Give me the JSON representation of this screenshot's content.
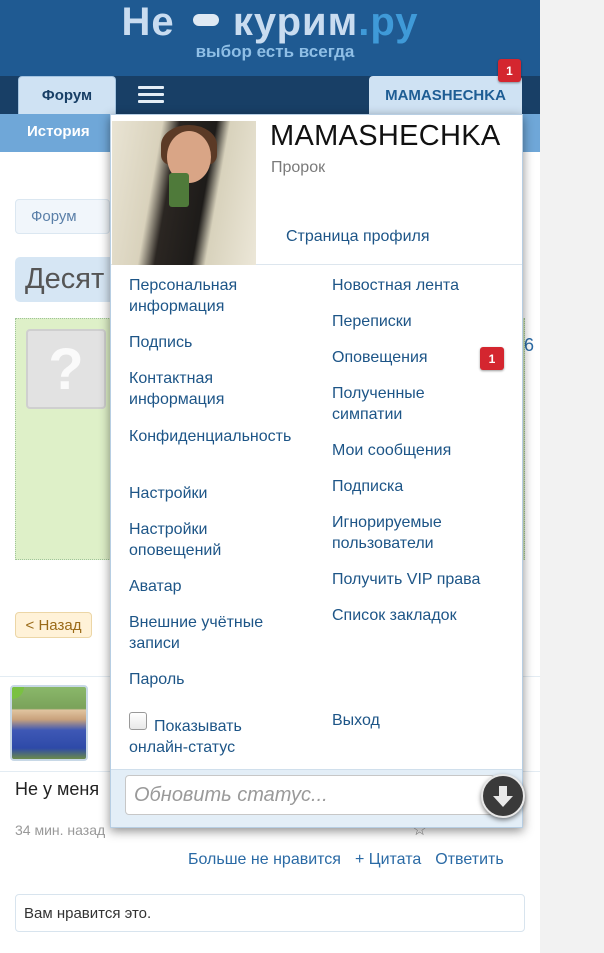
{
  "header": {
    "logo_main": "Не",
    "logo_mid": "курим",
    "logo_ru": ".ру",
    "logo_sub": "выбор есть всегда",
    "tab_forum": "Форум",
    "tab_user": "MAMASHECHKA",
    "user_badge": "1"
  },
  "subnav": {
    "history": "История"
  },
  "page": {
    "breadcrumb": "Форум",
    "thread_title": "Десят",
    "side_num": "6",
    "back_button": "< Назад",
    "post_text": "Не у меня",
    "post_time": "34 мин. назад",
    "actions": [
      "Больше не нравится",
      "+ Цитата",
      "Ответить"
    ],
    "like_text": "Вам нравится это."
  },
  "menu": {
    "name": "MAMASHECHKA",
    "rank": "Пророк",
    "profile_link": "Страница профиля",
    "left_items": [
      "Персональная информация",
      "Подпись",
      "Контактная информация",
      "Конфиденциальность",
      "Настройки",
      "Настройки оповещений",
      "Аватар",
      "Внешние учётные записи",
      "Пароль"
    ],
    "right_items": [
      "Новостная лента",
      "Переписки",
      "Оповещения",
      "Полученные симпатии",
      "Мои сообщения",
      "Подписка",
      "Игнорируемые пользователи",
      "Получить VIP права",
      "Список закладок"
    ],
    "alerts_badge": "1",
    "show_online": "Показывать онлайн-статус",
    "logout": "Выход",
    "status_placeholder": "Обновить статус..."
  },
  "colors": {
    "header_bg": "#1f5a92",
    "link": "#1d5587",
    "badge": "#d4262f"
  }
}
